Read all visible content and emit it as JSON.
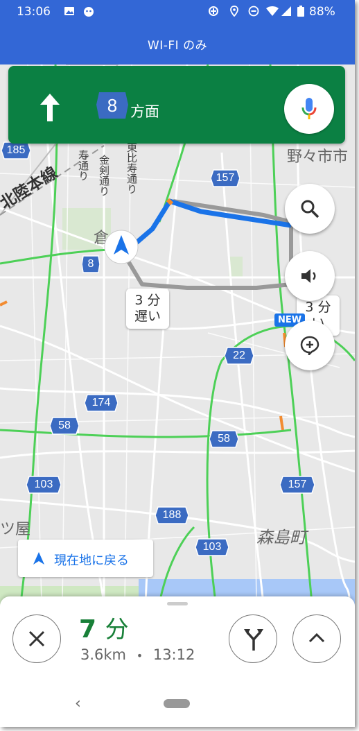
{
  "status_bar": {
    "time": "13:06",
    "battery": "88%"
  },
  "header": {
    "title": "WI-FI のみ"
  },
  "nav_card": {
    "route_number": "8",
    "direction": "方面"
  },
  "map": {
    "callout_primary": {
      "line1": "3 分",
      "line2": "遅い"
    },
    "callout_secondary": {
      "line1": "3 分",
      "line2": "い"
    },
    "new_badge": "NEW",
    "shields": [
      "185",
      "157",
      "8",
      "22",
      "174",
      "58",
      "58",
      "103",
      "157",
      "188",
      "103"
    ],
    "places": {
      "nonoichi": "野々市市",
      "morishima": "森島町",
      "tsuya": "ツ屋",
      "kura": "倉",
      "hokuriku_line": "北陸本線"
    },
    "roads": {
      "higashi_ebisu": "東比寿通り",
      "kanatsurugi": "金剣通り",
      "kanatsurugi2": "寿通り"
    }
  },
  "recenter": {
    "label": "現在地に戻る"
  },
  "bottom_panel": {
    "eta_minutes": "7",
    "eta_unit": "分",
    "distance": "3.6km",
    "separator": "•",
    "arrival_time": "13:12"
  }
}
